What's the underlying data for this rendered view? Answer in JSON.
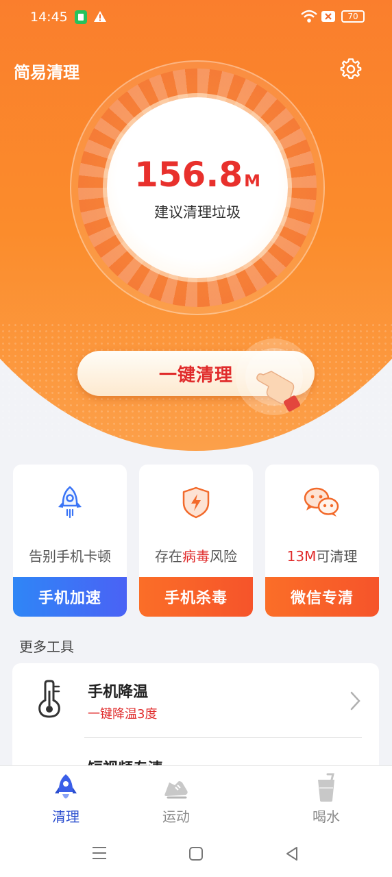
{
  "status_bar": {
    "time": "14:45",
    "battery": "70",
    "icons": [
      "app-notification-icon",
      "warning-icon",
      "wifi-icon",
      "sim-off-icon",
      "battery-icon"
    ]
  },
  "app": {
    "title": "简易清理"
  },
  "scan": {
    "amount": "156.8",
    "unit": "M",
    "label": "建议清理垃圾"
  },
  "clean_button": {
    "label": "一键清理"
  },
  "features": [
    {
      "icon": "rocket-icon",
      "desc_pre": "告别手机卡顿",
      "desc_hl": "",
      "desc_post": "",
      "button": "手机加速",
      "color": "#3a74f6"
    },
    {
      "icon": "shield-lightning-icon",
      "desc_pre": "存在",
      "desc_hl": "病毒",
      "desc_post": "风险",
      "button": "手机杀毒",
      "color": "#f8612a"
    },
    {
      "icon": "wechat-icon",
      "desc_pre": "",
      "desc_hl": "13M",
      "desc_post": "可清理",
      "button": "微信专清",
      "color": "#f8612a"
    }
  ],
  "more_tools": {
    "title": "更多工具",
    "items": [
      {
        "title": "手机降温",
        "subtitle": "一键降温3度",
        "icon": "thermometer-icon"
      },
      {
        "title": "短视频专清",
        "subtitle": "",
        "icon": "video-icon"
      }
    ]
  },
  "bottom_nav": {
    "items": [
      {
        "label": "清理",
        "icon": "rocket-icon",
        "active": true
      },
      {
        "label": "运动",
        "icon": "sneaker-icon",
        "active": false
      },
      {
        "label": "喝水",
        "icon": "cup-icon",
        "active": false
      }
    ]
  },
  "colors": {
    "accent_orange": "#f8612a",
    "accent_blue": "#3a74f6",
    "highlight_red": "#e02b2b",
    "active_nav": "#2c4fcf",
    "inactive_nav": "#8a8a8a"
  }
}
